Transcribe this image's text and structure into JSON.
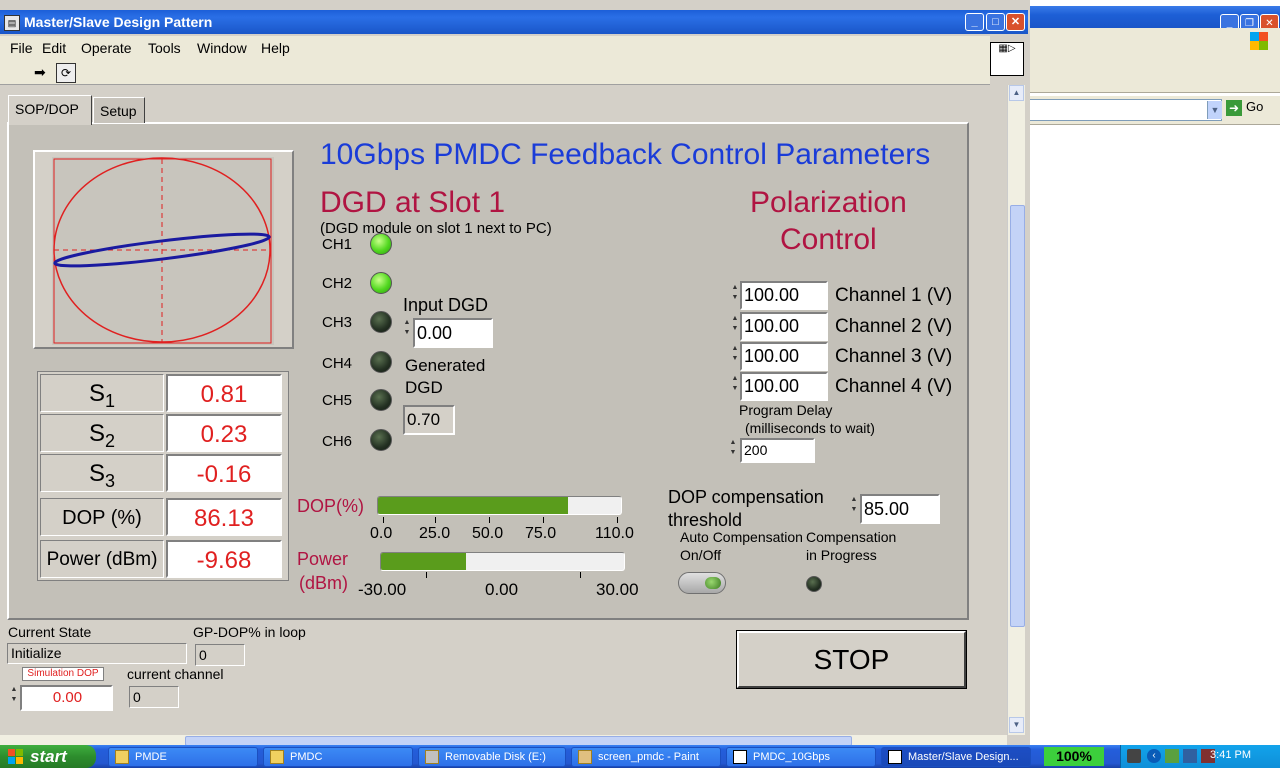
{
  "window": {
    "title": "Master/Slave Design Pattern"
  },
  "menu": [
    "File",
    "Edit",
    "Operate",
    "Tools",
    "Window",
    "Help"
  ],
  "tabs": [
    "SOP/DOP",
    "Setup"
  ],
  "main_title": "10Gbps PMDC Feedback Control Parameters",
  "dgd": {
    "title": "DGD at Slot 1",
    "subtitle": "(DGD module on slot 1 next to PC)",
    "channels": [
      {
        "label": "CH1",
        "on": true
      },
      {
        "label": "CH2",
        "on": true
      },
      {
        "label": "CH3",
        "on": false
      },
      {
        "label": "CH4",
        "on": false
      },
      {
        "label": "CH5",
        "on": false
      },
      {
        "label": "CH6",
        "on": false
      }
    ],
    "input_label": "Input DGD",
    "input_value": "0.00",
    "generated_label_1": "Generated",
    "generated_label_2": "DGD",
    "generated_value": "0.70"
  },
  "polarization": {
    "title_1": "Polarization",
    "title_2": "Control",
    "channels": [
      {
        "value": "100.00",
        "label": "Channel 1 (V)"
      },
      {
        "value": "100.00",
        "label": "Channel 2 (V)"
      },
      {
        "value": "100.00",
        "label": "Channel 3 (V)"
      },
      {
        "value": "100.00",
        "label": "Channel 4 (V)"
      }
    ],
    "delay_label_1": "Program Delay",
    "delay_label_2": "(milliseconds to wait)",
    "delay_value": "200"
  },
  "stokes": {
    "rows": [
      {
        "label": "S",
        "sub": "1",
        "value": "0.81"
      },
      {
        "label": "S",
        "sub": "2",
        "value": "0.23"
      },
      {
        "label": "S",
        "sub": "3",
        "value": "-0.16"
      },
      {
        "label": "DOP (%)",
        "sub": "",
        "value": "86.13"
      },
      {
        "label": "Power (dBm)",
        "sub": "",
        "value": "-9.68"
      }
    ]
  },
  "dop_bar": {
    "label": "DOP(%)",
    "fraction": 0.78,
    "ticks": [
      "0.0",
      "25.0",
      "50.0",
      "75.0",
      "110.0"
    ]
  },
  "power_bar": {
    "label_1": "Power",
    "label_2": "(dBm)",
    "fraction": 0.35,
    "ticks": [
      "-30.00",
      "0.00",
      "30.00"
    ]
  },
  "dop_comp": {
    "label_1": "DOP compensation",
    "label_2": "threshold",
    "value": "85.00",
    "auto_label_1": "Auto Compensation",
    "auto_label_2": "On/Off",
    "progress_label_1": "Compensation",
    "progress_label_2": "in Progress"
  },
  "status": {
    "state_label": "Current State",
    "state_value": "Initialize",
    "gp_label": "GP-DOP% in loop",
    "gp_value": "0",
    "sim_label": "Simulation DOP",
    "sim_value": "0.00",
    "channel_label": "current channel",
    "channel_value": "0"
  },
  "stop_label": "STOP",
  "bg_window": {
    "go_label": "Go"
  },
  "taskbar": {
    "start_label": "start",
    "items": [
      {
        "label": "PMDE",
        "active": false
      },
      {
        "label": "PMDC",
        "active": false
      },
      {
        "label": "Removable Disk (E:)",
        "active": false
      },
      {
        "label": "screen_pmdc - Paint",
        "active": false
      },
      {
        "label": "PMDC_10Gbps",
        "active": false
      },
      {
        "label": "Master/Slave Design...",
        "active": true
      }
    ],
    "zoom": "100%",
    "clock": "3:41 PM"
  },
  "colors": {
    "title_blue": "#1a3cd8",
    "heading_red": "#b01442",
    "value_red": "#e02020",
    "bar_green": "#5a9c1c"
  }
}
